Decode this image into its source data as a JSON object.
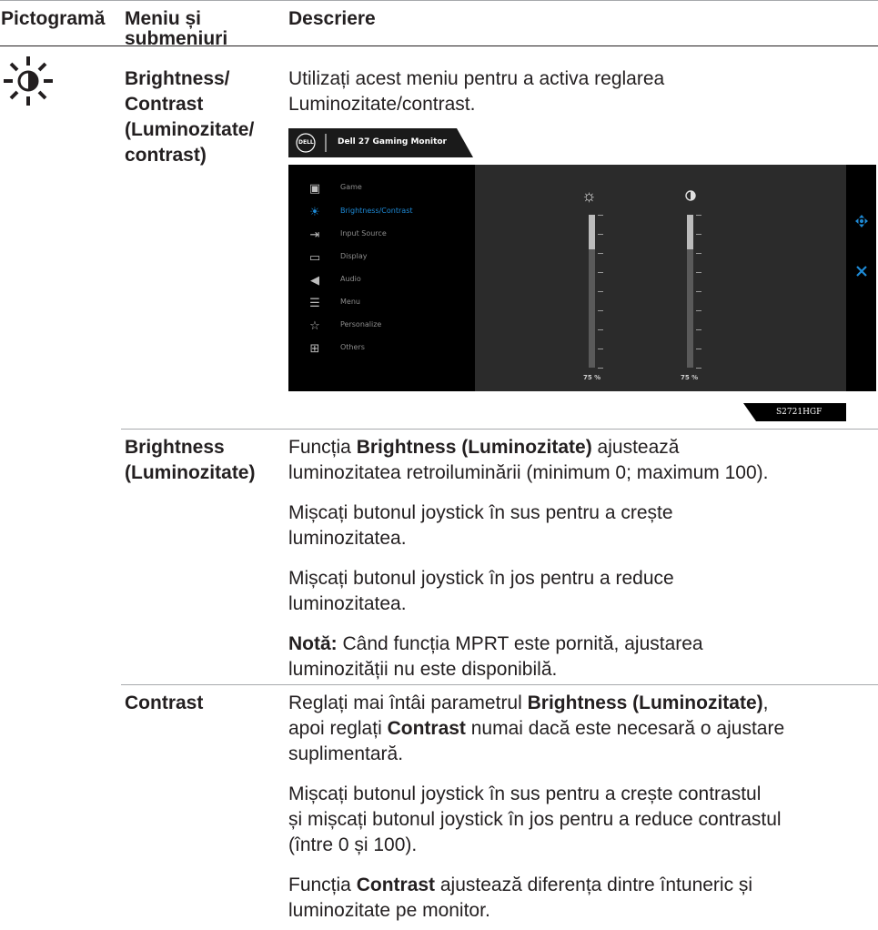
{
  "header": {
    "col1": "Pictogramă",
    "col2_line1": "Meniu și",
    "col2_line2": "submeniuri",
    "col3": "Descriere"
  },
  "brightness_contrast": {
    "menu": [
      "Brightness/",
      "Contrast",
      "(Luminozitate/",
      "contrast)"
    ],
    "desc_line1": "Utilizați acest meniu pentru a activa reglarea",
    "desc_line2": "Luminozitate/contrast."
  },
  "osd": {
    "tab_title": "Dell 27 Gaming Monitor",
    "logo_text": "DELL",
    "menu_items": [
      {
        "label": "Game",
        "icon": "game-icon"
      },
      {
        "label": "Brightness/Contrast",
        "icon": "brightness-icon"
      },
      {
        "label": "Input Source",
        "icon": "input-source-icon"
      },
      {
        "label": "Display",
        "icon": "display-icon"
      },
      {
        "label": "Audio",
        "icon": "audio-icon"
      },
      {
        "label": "Menu",
        "icon": "menu-icon"
      },
      {
        "label": "Personalize",
        "icon": "star-icon"
      },
      {
        "label": "Others",
        "icon": "others-icon"
      }
    ],
    "active_index": 1,
    "brightness_value": 75,
    "contrast_value": 75,
    "brightness_label": "75 %",
    "contrast_label": "75 %",
    "model": "S2721HGF",
    "accent_color": "#1e8ad6"
  },
  "brightness": {
    "menu_line1": "Brightness",
    "menu_line2": "(Luminozitate)",
    "p1_pre": "Funcția ",
    "p1_bold": "Brightness (Luminozitate)",
    "p1_post": " ajustează",
    "p1_line2": "luminozitatea retroiluminării (minimum 0; maximum 100).",
    "p2_line1": "Mișcați butonul joystick în sus pentru a crește",
    "p2_line2": "luminozitatea.",
    "p3_line1": "Mișcați butonul joystick în jos pentru a reduce",
    "p3_line2": "luminozitatea.",
    "note_bold": "Notă:",
    "note_line1": " Când funcția MPRT este pornită, ajustarea",
    "note_line2": "luminozității nu este disponibilă."
  },
  "contrast": {
    "menu": "Contrast",
    "p1_pre": "Reglați mai întâi parametrul ",
    "p1_bold": "Brightness (Luminozitate)",
    "p1_post": ",",
    "p1_line2_pre": "apoi reglați ",
    "p1_line2_bold": "Contrast",
    "p1_line2_post": " numai dacă este necesară o ajustare",
    "p1_line3": "suplimentară.",
    "p2_line1": "Mișcați butonul joystick în sus pentru a crește contrastul",
    "p2_line2": "și mișcați butonul joystick în jos pentru a reduce contrastul",
    "p2_line3": "(între 0 și 100).",
    "p3_pre": "Funcția ",
    "p3_bold": "Contrast",
    "p3_post": " ajustează diferența dintre întuneric și",
    "p3_line2": "luminozitate pe monitor."
  }
}
